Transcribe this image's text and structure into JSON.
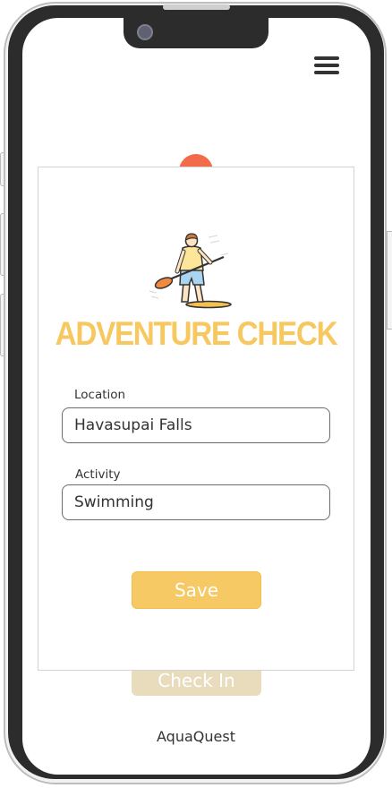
{
  "app": {
    "name": "AquaQuest"
  },
  "modal": {
    "title": "ADVENTURE CHECK",
    "illustration_icon": "paddleboarder-icon",
    "fields": {
      "location": {
        "label": "Location",
        "value": "Havasupai Falls"
      },
      "activity": {
        "label": "Activity",
        "value": "Swimming"
      }
    },
    "save_label": "Save"
  },
  "background_screen": {
    "check_in_label": "Check In"
  },
  "colors": {
    "accent": "#f7c964",
    "title": "#f7c860",
    "dot": "#f26b4b",
    "check_in_disabled": "#e8dcbc"
  }
}
